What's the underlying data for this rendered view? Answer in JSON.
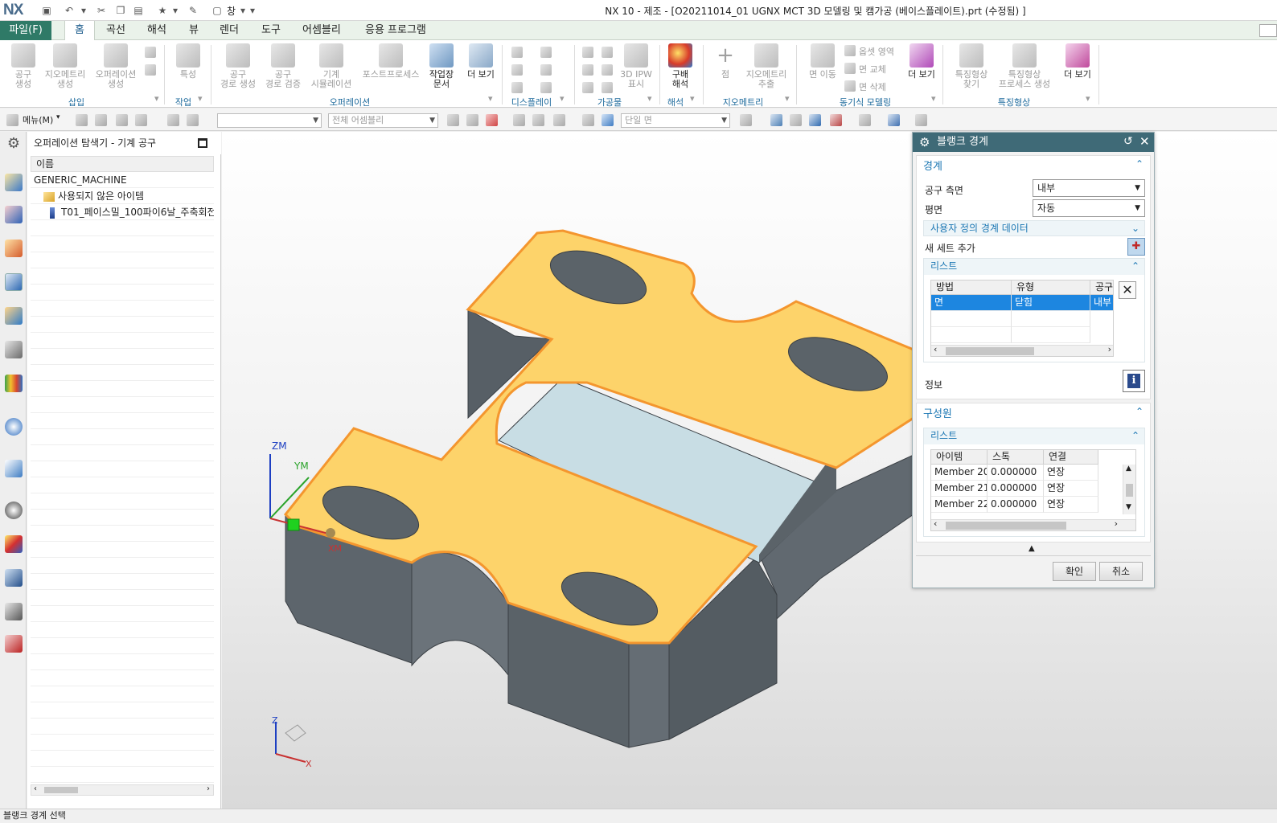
{
  "app": {
    "logo": "NX",
    "title": "NX 10 - 제조 - [O20211014_01 UGNX MCT 3D 모델링 및 캠가공 (베이스플레이트).prt (수정됨) ]",
    "window_menu": "창"
  },
  "tabs": [
    {
      "label": "파일(F)"
    },
    {
      "label": "홈"
    },
    {
      "label": "곡선"
    },
    {
      "label": "해석"
    },
    {
      "label": "뷰"
    },
    {
      "label": "렌더"
    },
    {
      "label": "도구"
    },
    {
      "label": "어셈블리"
    },
    {
      "label": "응용 프로그램"
    }
  ],
  "ribbon": {
    "insert": {
      "group": "삽입",
      "tool": "공구\n생성",
      "geometry": "지오메트리\n생성",
      "operation": "오퍼레이션\n생성"
    },
    "work": {
      "group": "작업",
      "property": "특성"
    },
    "operation": {
      "group": "오퍼레이션",
      "gen_path": "공구\n경로 생성",
      "verify_path": "공구\n경로 검증",
      "machine_sim": "기계\n시뮬레이션",
      "postprocess": "포스트프로세스",
      "shop_doc": "작업장\n문서",
      "more": "더 보기"
    },
    "display": {
      "group": "디스플레이"
    },
    "workpiece": {
      "group": "가공물",
      "ipw": "3D IPW\n표시"
    },
    "analysis": {
      "group": "해석",
      "gouge": "구배\n해석"
    },
    "geometry": {
      "group": "지오메트리",
      "point": "점",
      "extract": "지오메트리\n추출"
    },
    "sync": {
      "group": "동기식 모델링",
      "move_face": "면 이동",
      "offset_region": "옵셋 영역",
      "replace_face": "면 교체",
      "delete_face": "면 삭제",
      "more": "더 보기"
    },
    "feature": {
      "group": "특징형상",
      "find": "특징형상\n찾기",
      "process": "특징형상\n프로세스 생성",
      "more": "더 보기"
    }
  },
  "toolbar": {
    "menu": "메뉴(M)",
    "filter_empty": "",
    "assembly_scope": "전체 어셈블리",
    "face_rule": "단일 면"
  },
  "navigator": {
    "title": "오퍼레이션 탐색기 - 기계 공구",
    "column": "이름",
    "root": "GENERIC_MACHINE",
    "items": [
      {
        "label": "사용되지 않은 아이템"
      },
      {
        "label": "T01_페이스밀_100파이6날_주축회전"
      }
    ]
  },
  "viewport": {
    "axis_zm": "ZM",
    "axis_ym": "YM",
    "axis_xm": "XM",
    "triad_z": "Z",
    "triad_x": "X"
  },
  "dialog": {
    "title": "블랭크 경계",
    "boundary": {
      "header": "경계",
      "tool_side_label": "공구 측면",
      "tool_side_value": "내부",
      "plane_label": "평면",
      "plane_value": "자동",
      "custom_header": "사용자 정의 경계 데이터",
      "add_set_label": "새 세트 추가",
      "list_header": "리스트",
      "columns": [
        "방법",
        "유형",
        "공구"
      ],
      "rows": [
        [
          "면",
          "닫힘",
          "내부"
        ]
      ],
      "info_label": "정보"
    },
    "members": {
      "header": "구성원",
      "list_header": "리스트",
      "columns": [
        "아이템",
        "스톡",
        "연결"
      ],
      "rows": [
        [
          "Member 20",
          "0.000000",
          "연장"
        ],
        [
          "Member 21",
          "0.000000",
          "연장"
        ],
        [
          "Member 22",
          "0.000000",
          "연장"
        ]
      ]
    },
    "ok": "확인",
    "cancel": "취소"
  },
  "status": {
    "text": "블랭크 경계 선택"
  }
}
